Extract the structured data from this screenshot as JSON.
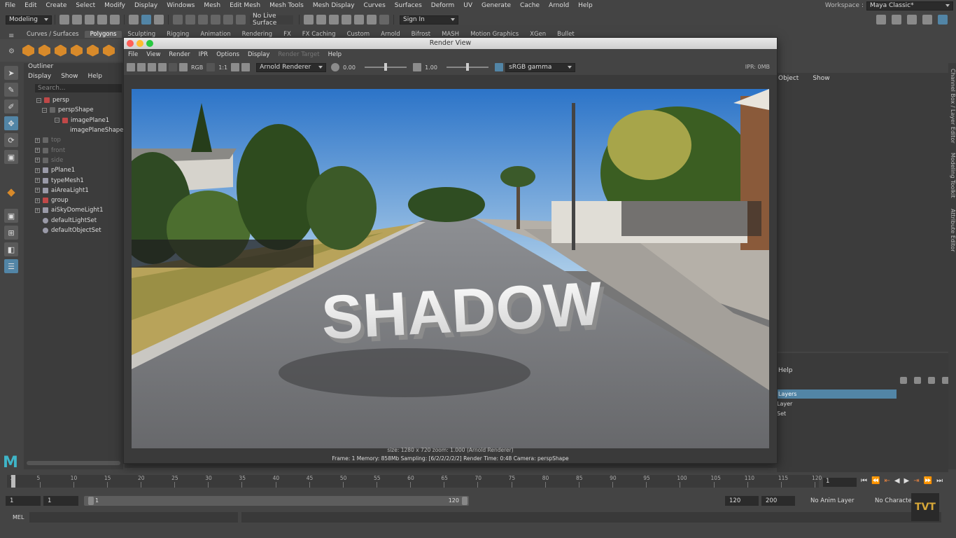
{
  "menubar": [
    "File",
    "Edit",
    "Create",
    "Select",
    "Modify",
    "Display",
    "Windows",
    "Mesh",
    "Edit Mesh",
    "Mesh Tools",
    "Mesh Display",
    "Curves",
    "Surfaces",
    "Deform",
    "UV",
    "Generate",
    "Cache",
    "Arnold",
    "Help"
  ],
  "workspace": {
    "label": "Workspace :",
    "value": "Maya Classic*"
  },
  "statusline": {
    "mode": "Modeling",
    "live_surface": "No Live Surface",
    "sign_in": "Sign In"
  },
  "shelf_tabs": [
    "Curves / Surfaces",
    "Polygons",
    "Sculpting",
    "Rigging",
    "Animation",
    "Rendering",
    "FX",
    "FX Caching",
    "Custom",
    "Arnold",
    "Bifrost",
    "MASH",
    "Motion Graphics",
    "XGen",
    "Bullet"
  ],
  "outliner": {
    "title": "Outliner",
    "menu": [
      "Display",
      "Show",
      "Help"
    ],
    "search_placeholder": "Search...",
    "items": [
      {
        "label": "persp"
      },
      {
        "label": "perspShape"
      },
      {
        "label": "imagePlane1"
      },
      {
        "label": "imagePlaneShape1"
      },
      {
        "label": "top"
      },
      {
        "label": "front"
      },
      {
        "label": "side"
      },
      {
        "label": "pPlane1"
      },
      {
        "label": "typeMesh1"
      },
      {
        "label": "aiAreaLight1"
      },
      {
        "label": "group"
      },
      {
        "label": "aiSkyDomeLight1"
      },
      {
        "label": "defaultLightSet"
      },
      {
        "label": "defaultObjectSet"
      }
    ]
  },
  "render_view": {
    "title": "Render View",
    "menu": [
      "File",
      "View",
      "Render",
      "IPR",
      "Options",
      "Display",
      "Render Target",
      "Help"
    ],
    "ratio_label": "1:1",
    "rgb_label": "RGB",
    "renderer": "Arnold Renderer",
    "exposure": "0.00",
    "gamma": "1.00",
    "color_space": "sRGB gamma",
    "ipr_mem": "IPR: 0MB",
    "render_text": "SHADOW",
    "info_line1": "size: 1280 x 720  zoom: 1.000     (Arnold Renderer)",
    "info_line2": "Frame: 1     Memory: 858Mb     Sampling: [6/2/2/2/2/2]     Render Time: 0:48     Camera: perspShape"
  },
  "right_panel": {
    "menu": [
      "Object",
      "Show"
    ],
    "help": "Help",
    "list": [
      "Layers",
      "Layer",
      "Set"
    ]
  },
  "side_tabs": [
    "Channel Box / Layer Editor",
    "Modeling Toolkit",
    "Attribute Editor"
  ],
  "timeline": {
    "ticks": [
      "1",
      "5",
      "10",
      "15",
      "20",
      "25",
      "30",
      "35",
      "40",
      "45",
      "50",
      "55",
      "60",
      "65",
      "70",
      "75",
      "80",
      "85",
      "90",
      "95",
      "100",
      "105",
      "110",
      "115",
      "120"
    ],
    "current_frame": "1"
  },
  "range": {
    "start": "1",
    "start2": "1",
    "range_start": "1",
    "range_end": "120",
    "end": "120",
    "end2": "200",
    "anim_layer": "No Anim Layer",
    "character": "No Character Set"
  },
  "cmdline": {
    "label": "MEL"
  },
  "logo": "TVT"
}
